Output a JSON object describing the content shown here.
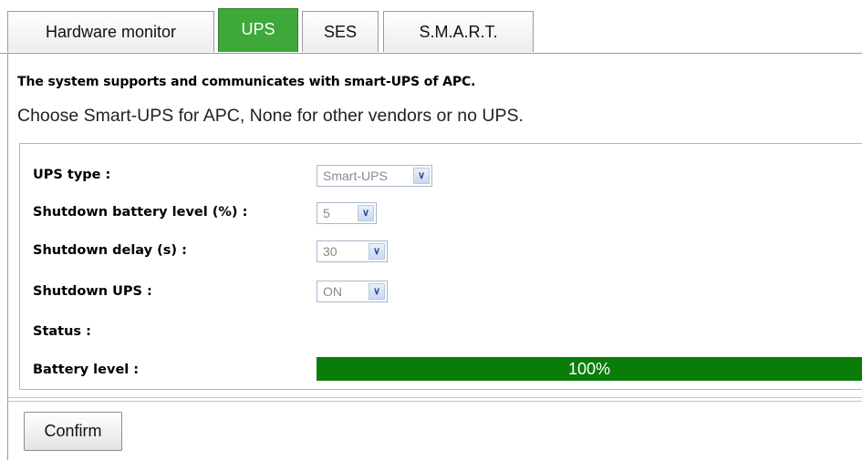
{
  "tabs": [
    {
      "label": "Hardware monitor",
      "active": false
    },
    {
      "label": "UPS",
      "active": true
    },
    {
      "label": "SES",
      "active": false
    },
    {
      "label": "S.M.A.R.T.",
      "active": false
    }
  ],
  "description": {
    "line1": "The system supports and communicates with smart-UPS of APC.",
    "line2": "Choose Smart-UPS for APC, None for other vendors or no UPS."
  },
  "settings": {
    "ups_type": {
      "label": "UPS type :",
      "value": "Smart-UPS"
    },
    "shutdown_battery_level": {
      "label": "Shutdown battery level (%) :",
      "value": "5"
    },
    "shutdown_delay": {
      "label": "Shutdown delay (s) :",
      "value": "30"
    },
    "shutdown_ups": {
      "label": "Shutdown UPS :",
      "value": "ON"
    },
    "status": {
      "label": "Status :",
      "value": ""
    },
    "battery_level": {
      "label": "Battery level :",
      "text": "100%",
      "fraction": 1.0
    }
  },
  "colors": {
    "active_tab": "#3ea83b",
    "progress_fill": "#0a7c0a"
  },
  "icons": {
    "dropdown": "chevron-down-icon"
  },
  "actions": {
    "confirm_label": "Confirm"
  }
}
